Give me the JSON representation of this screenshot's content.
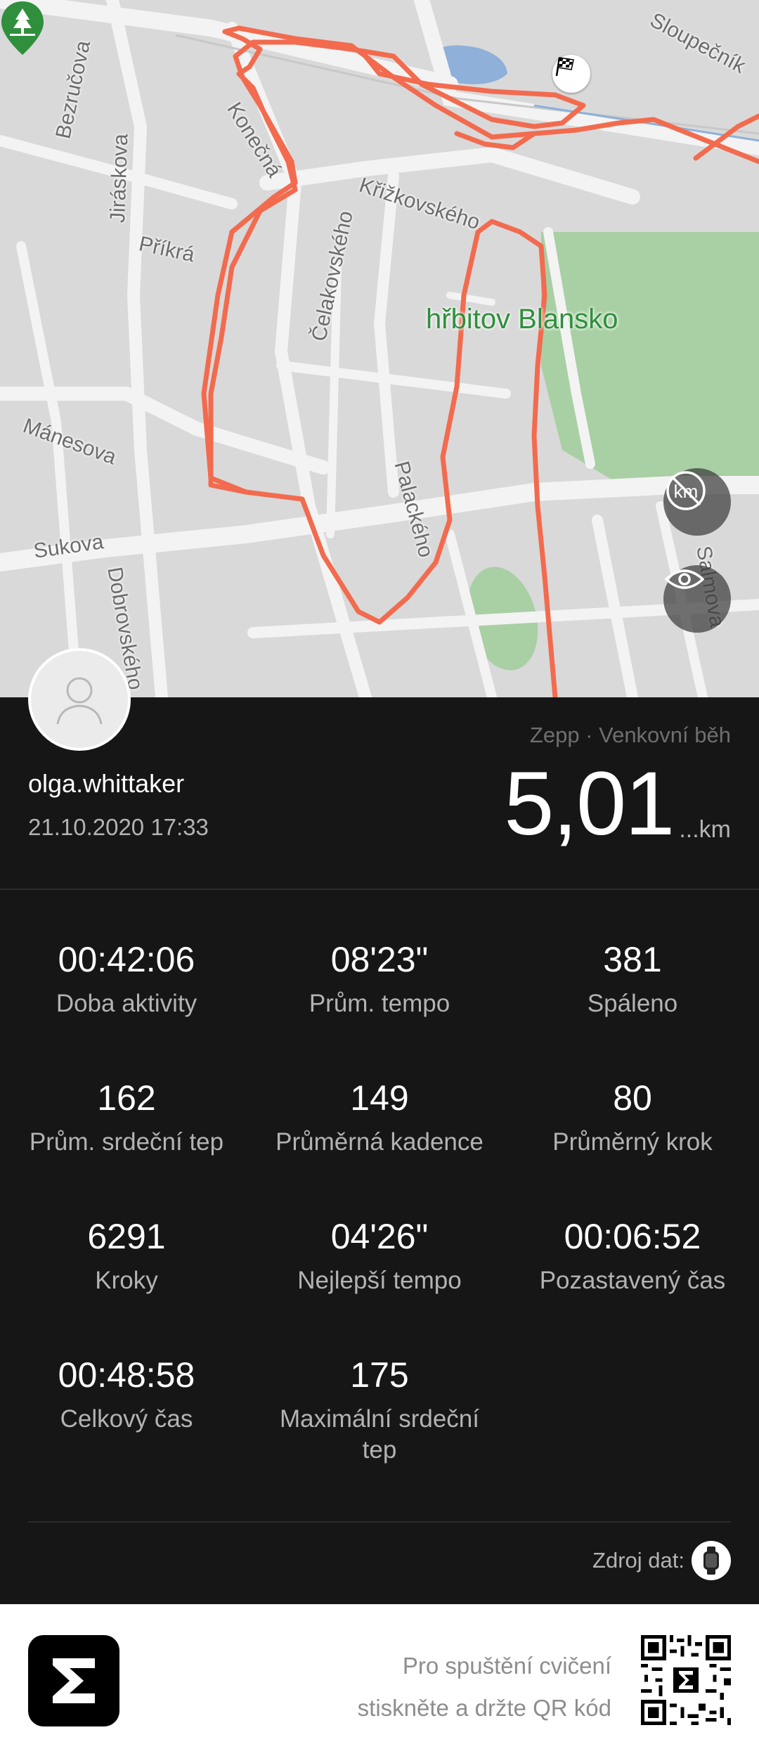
{
  "map": {
    "streets": [
      "Sloupečník",
      "Bezručova",
      "Jiráskova",
      "Konečná",
      "Křižkovského",
      "Příkrá",
      "Čelakovského",
      "Mánesova",
      "Palackého",
      "Sukova",
      "Dobrovského",
      "Salmova"
    ],
    "poi_label": "hřbitov Blansko",
    "poi_icon": "tree-pin-icon",
    "finish_icon": "checkered-flag-icon",
    "buttons": [
      {
        "name": "hide-km-markers-button",
        "icon": "km-off-icon"
      },
      {
        "name": "visibility-button",
        "icon": "eye-icon"
      }
    ],
    "route_color": "#f26b4f",
    "park_color": "#a9cfa4",
    "water_color": "#8eb0d9"
  },
  "profile": {
    "username": "olga.whittaker",
    "datetime": "21.10.2020 17:33",
    "avatar_icon": "user-avatar-icon"
  },
  "summary": {
    "source_type": "Zepp · Venkovní běh",
    "distance_value": "5,01",
    "distance_unit": "...km"
  },
  "stats": [
    {
      "value": "00:42:06",
      "label": "Doba aktivity"
    },
    {
      "value": "08'23\"",
      "label": "Prům. tempo"
    },
    {
      "value": "381",
      "label": "Spáleno"
    },
    {
      "value": "162",
      "label": "Prům. srdeční tep"
    },
    {
      "value": "149",
      "label": "Průměrná kadence"
    },
    {
      "value": "80",
      "label": "Průměrný krok"
    },
    {
      "value": "6291",
      "label": "Kroky"
    },
    {
      "value": "04'26\"",
      "label": "Nejlepší tempo"
    },
    {
      "value": "00:06:52",
      "label": "Pozastavený čas"
    },
    {
      "value": "00:48:58",
      "label": "Celkový čas"
    },
    {
      "value": "175",
      "label": "Maximální srdeční tep"
    }
  ],
  "data_source": {
    "label": "Zdroj dat:",
    "icon": "watch-icon"
  },
  "footer": {
    "logo_icon": "zepp-sigma-logo",
    "line1": "Pro spuštění cvičení",
    "line2": "stiskněte a držte QR kód",
    "qr_icon": "qr-code-icon"
  }
}
